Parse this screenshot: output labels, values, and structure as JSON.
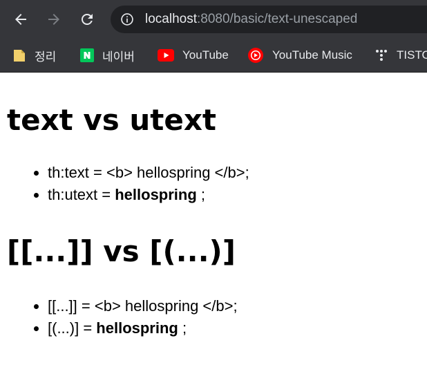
{
  "browser": {
    "url_host": "localhost",
    "url_rest": ":8080/basic/text-unescaped",
    "bookmarks": [
      {
        "label": "정리",
        "icon": "folder-icon"
      },
      {
        "label": "네이버",
        "icon": "naver-icon"
      },
      {
        "label": "YouTube",
        "icon": "youtube-icon"
      },
      {
        "label": "YouTube Music",
        "icon": "youtube-music-icon"
      },
      {
        "label": "TISTO",
        "icon": "tistory-icon"
      }
    ]
  },
  "page": {
    "section1": {
      "title": "text vs utext",
      "items": [
        {
          "prefix": "th:text = ",
          "content": "<b> hellospring </b>",
          "suffix": ";"
        },
        {
          "prefix": "th:utext = ",
          "content": "hellospring",
          "suffix": " ;"
        }
      ]
    },
    "section2": {
      "title": "[[...]] vs [(...)]",
      "items": [
        {
          "prefix": "[[...]] = ",
          "content": "<b> hellospring </b>",
          "suffix": ";"
        },
        {
          "prefix": "[(...)] = ",
          "content": "hellospring",
          "suffix": " ;"
        }
      ]
    }
  },
  "colors": {
    "chrome_bg": "#35363a",
    "omnibox_bg": "#202124",
    "naver_green": "#03c75a",
    "youtube_red": "#ff0000",
    "folder_yellow": "#f2d06b"
  }
}
